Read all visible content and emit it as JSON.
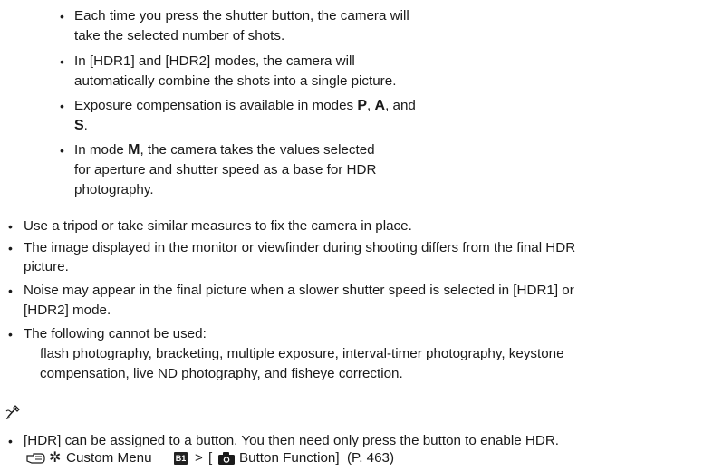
{
  "inner_list": {
    "items": [
      {
        "lines": [
          "Each time you press the shutter button, the camera will",
          "take the selected number of shots."
        ]
      },
      {
        "lines": [
          "In [HDR1] and [HDR2] modes, the camera will",
          "automatically combine the shots into a single picture."
        ]
      },
      {
        "line1_pre": "Exposure compensation is available in modes ",
        "mode_p": "P",
        "sep1": ", ",
        "mode_a": "A",
        "sep2": ", and",
        "mode_s": "S",
        "end": "."
      },
      {
        "line1_pre": "In mode ",
        "mode_m": "M",
        "line1_post": ", the camera takes the values selected",
        "lines": [
          "for aperture and shutter speed as a base for HDR",
          "photography."
        ]
      }
    ]
  },
  "notes": {
    "items": [
      {
        "lines": [
          "Use a tripod or take similar measures to fix the camera in place."
        ]
      },
      {
        "lines": [
          "The image displayed in the monitor or viewfinder during shooting differs from the final HDR",
          "picture."
        ]
      },
      {
        "lines": [
          "Noise may appear in the final picture when a slower shutter speed is selected in [HDR1] or",
          "[HDR2] mode."
        ]
      },
      {
        "lines": [
          "The following cannot be used:",
          "flash photography, bracketing, multiple exposure, interval-timer photography, keystone",
          "compensation, live ND photography, and fisheye correction."
        ]
      }
    ]
  },
  "tips": {
    "icon": "tip-pen-icon",
    "items": [
      {
        "lines": [
          "[HDR] can be assigned to a button. You then need only press the button to enable HDR."
        ]
      }
    ],
    "reference": {
      "ref_icon": "reference-hand-icon",
      "gear_icon": "gear-icon",
      "menu_label": "Custom Menu",
      "menu_badge": "B1",
      "separator": ">",
      "bracket_open": "[",
      "camera_icon": "camera-icon",
      "function_label": "Button Function]",
      "page_ref": "(P. 463)"
    }
  }
}
